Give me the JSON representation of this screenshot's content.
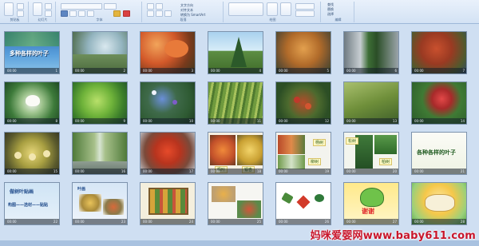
{
  "ribbon": {
    "groups": [
      "剪贴板",
      "幻灯片",
      "字体",
      "段落",
      "绘图",
      "编辑"
    ],
    "text_direction": "文字方向",
    "align_text": "对齐文本",
    "smartart": "转换为 SmartArt",
    "find": "查找",
    "replace": "替换",
    "select": "选择"
  },
  "slides": [
    {
      "num": "1",
      "title": "多种各样的叶子"
    },
    {
      "num": "2"
    },
    {
      "num": "3"
    },
    {
      "num": "4"
    },
    {
      "num": "5"
    },
    {
      "num": "6"
    },
    {
      "num": "7"
    },
    {
      "num": "8"
    },
    {
      "num": "9"
    },
    {
      "num": "10"
    },
    {
      "num": "11"
    },
    {
      "num": "12"
    },
    {
      "num": "13"
    },
    {
      "num": "14"
    },
    {
      "num": "15"
    },
    {
      "num": "16"
    },
    {
      "num": "17"
    },
    {
      "num": "18",
      "captions": [
        "枫叶",
        "银杏"
      ]
    },
    {
      "num": "19",
      "captions": [
        "杨树",
        "柳树"
      ]
    },
    {
      "num": "20",
      "captions": [
        "松树",
        "柏树"
      ]
    },
    {
      "num": "21",
      "title": "各种各样的叶子"
    },
    {
      "num": "22",
      "title": "做树叶贴画",
      "subtitle": "构图——选材——贴贴"
    },
    {
      "num": "23",
      "title": "叶画"
    },
    {
      "num": "24"
    },
    {
      "num": "25"
    },
    {
      "num": "26"
    },
    {
      "num": "27",
      "title": "谢谢"
    },
    {
      "num": "28"
    }
  ],
  "meta_label": "00:00",
  "watermark": "妈咪爱婴网www.baby611.com",
  "colors": {
    "ribbon": "#dce8f6",
    "background": "#cfdff2",
    "watermark": "#c8152b"
  }
}
